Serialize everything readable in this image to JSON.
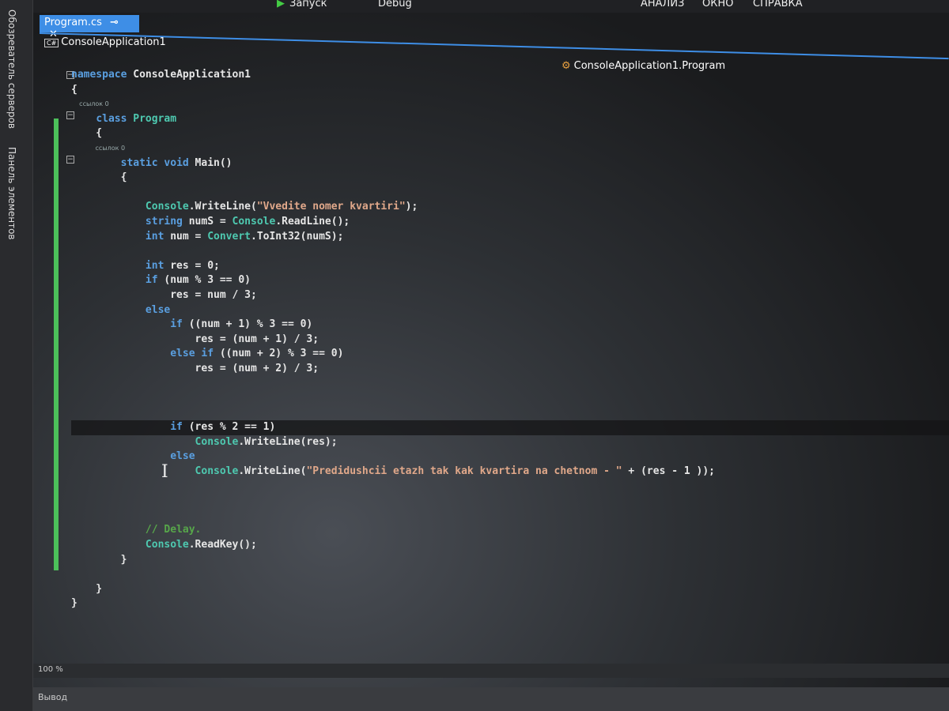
{
  "toolbar": {
    "run_label": "Запуск",
    "config": "Debug",
    "menu_analyze": "АНАЛИЗ",
    "menu_window": "ОКНО",
    "menu_help": "СПРАВКА"
  },
  "side_tabs": [
    "Обозреватель серверов",
    "Панель элементов"
  ],
  "tab": {
    "name": "Program.cs",
    "pin": "⊸",
    "close": "✕"
  },
  "nav": {
    "project": "ConsoleApplication1",
    "cs_badge": "C#",
    "member": "ConsoleApplication1.Program"
  },
  "code": [
    {
      "t": [
        [
          "kw",
          "namespace "
        ],
        [
          "pl",
          "ConsoleApplication1"
        ]
      ]
    },
    {
      "t": [
        [
          "pl",
          "{"
        ]
      ]
    },
    {
      "lens": "    ссылок 0"
    },
    {
      "t": [
        [
          "pl",
          "    "
        ],
        [
          "kw",
          "class "
        ],
        [
          "ty",
          "Program"
        ]
      ]
    },
    {
      "t": [
        [
          "pl",
          "    {"
        ]
      ]
    },
    {
      "lens": "            ссылок 0"
    },
    {
      "t": [
        [
          "pl",
          "        "
        ],
        [
          "kw",
          "static void "
        ],
        [
          "pl",
          "Main()"
        ]
      ]
    },
    {
      "t": [
        [
          "pl",
          "        {"
        ]
      ]
    },
    {
      "t": []
    },
    {
      "t": [
        [
          "pl",
          "            "
        ],
        [
          "ty",
          "Console"
        ],
        [
          "pl",
          ".WriteLine("
        ],
        [
          "st",
          "\"Vvedite nomer kvartiri\""
        ],
        [
          "pl",
          ");"
        ]
      ]
    },
    {
      "t": [
        [
          "pl",
          "            "
        ],
        [
          "kw",
          "string "
        ],
        [
          "pl",
          "numS = "
        ],
        [
          "ty",
          "Console"
        ],
        [
          "pl",
          ".ReadLine();"
        ]
      ]
    },
    {
      "t": [
        [
          "pl",
          "            "
        ],
        [
          "kw",
          "int "
        ],
        [
          "pl",
          "num = "
        ],
        [
          "ty",
          "Convert"
        ],
        [
          "pl",
          ".ToInt32(numS);"
        ]
      ]
    },
    {
      "t": []
    },
    {
      "t": [
        [
          "pl",
          "            "
        ],
        [
          "kw",
          "int "
        ],
        [
          "pl",
          "res = 0;"
        ]
      ]
    },
    {
      "t": [
        [
          "pl",
          "            "
        ],
        [
          "kw",
          "if "
        ],
        [
          "pl",
          "(num % 3 == 0)"
        ]
      ]
    },
    {
      "t": [
        [
          "pl",
          "                res = num / 3;"
        ]
      ]
    },
    {
      "t": [
        [
          "pl",
          "            "
        ],
        [
          "kw",
          "else"
        ]
      ]
    },
    {
      "t": [
        [
          "pl",
          "                "
        ],
        [
          "kw",
          "if "
        ],
        [
          "pl",
          "((num + 1) % 3 == 0)"
        ]
      ]
    },
    {
      "t": [
        [
          "pl",
          "                    res = (num + 1) / 3;"
        ]
      ]
    },
    {
      "t": [
        [
          "pl",
          "                "
        ],
        [
          "kw",
          "else if "
        ],
        [
          "pl",
          "((num + 2) % 3 == 0)"
        ]
      ]
    },
    {
      "t": [
        [
          "pl",
          "                    res = (num + 2) / 3;"
        ]
      ]
    },
    {
      "t": []
    },
    {
      "t": []
    },
    {
      "t": []
    },
    {
      "cur": true,
      "t": [
        [
          "pl",
          "                "
        ],
        [
          "kw",
          "if "
        ],
        [
          "pl",
          "(res % 2 == 1)"
        ]
      ]
    },
    {
      "t": [
        [
          "pl",
          "                    "
        ],
        [
          "ty",
          "Console"
        ],
        [
          "pl",
          ".WriteLine(res);"
        ]
      ]
    },
    {
      "t": [
        [
          "pl",
          "                "
        ],
        [
          "kw",
          "else"
        ]
      ]
    },
    {
      "t": [
        [
          "pl",
          "                    "
        ],
        [
          "ty",
          "Console"
        ],
        [
          "pl",
          ".WriteLine("
        ],
        [
          "st",
          "\"Predidushcii etazh tak kak kvartira na chetnom - \""
        ],
        [
          "pl",
          " + (res - 1 ));"
        ]
      ]
    },
    {
      "t": []
    },
    {
      "t": []
    },
    {
      "t": []
    },
    {
      "t": [
        [
          "pl",
          "            "
        ],
        [
          "cm",
          "// Delay."
        ]
      ]
    },
    {
      "t": [
        [
          "pl",
          "            "
        ],
        [
          "ty",
          "Console"
        ],
        [
          "pl",
          ".ReadKey();"
        ]
      ]
    },
    {
      "t": [
        [
          "pl",
          "        }"
        ]
      ]
    },
    {
      "t": []
    },
    {
      "t": [
        [
          "pl",
          "    }"
        ]
      ]
    },
    {
      "t": [
        [
          "pl",
          "}"
        ]
      ]
    }
  ],
  "status": {
    "zoom": "100 %"
  },
  "output": {
    "label": "Вывод"
  }
}
